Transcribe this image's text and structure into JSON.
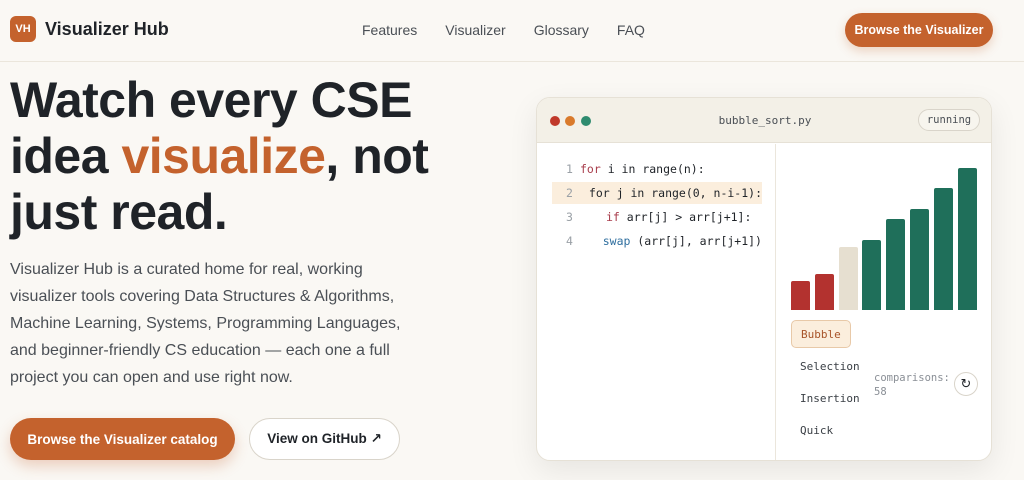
{
  "header": {
    "logo_text": "VH",
    "brand": "Visualizer Hub",
    "nav": [
      {
        "label": "Features"
      },
      {
        "label": "Visualizer"
      },
      {
        "label": "Glossary"
      },
      {
        "label": "FAQ"
      }
    ],
    "cta": "Browse the Visualizer"
  },
  "hero": {
    "title_part1": "Watch every CSE idea ",
    "title_accent": "visualize",
    "title_part2": ", not just read.",
    "description": "Visualizer Hub is a curated home for real, working visualizer tools covering Data Structures & Algorithms, Machine Learning, Systems, Programming Languages, and beginner-friendly CS education — each one a full project you can open and use right now.",
    "primary_button": "Browse the Visualizer catalog",
    "secondary_button": "View on GitHub ↗"
  },
  "visualizer": {
    "filename": "bubble_sort.py",
    "status": "running",
    "code": [
      {
        "num": "1",
        "keyword": "for",
        "keyword_type": "kw",
        "rest": " i in range(n):",
        "indent": 0,
        "highlight": false
      },
      {
        "num": "2",
        "keyword": "",
        "keyword_type": "kw",
        "rest": "for j in range(0, n-i-1):",
        "indent": 1,
        "highlight": true
      },
      {
        "num": "3",
        "keyword": "if",
        "keyword_type": "kw",
        "rest": " arr[j] > arr[j+1]:",
        "indent": 2,
        "highlight": false
      },
      {
        "num": "4",
        "keyword": "swap",
        "keyword_type": "fn",
        "rest": " (arr[j], arr[j+1])",
        "indent": 3,
        "highlight": false
      }
    ],
    "bars": [
      {
        "value": 29,
        "state": "compare"
      },
      {
        "value": 36,
        "state": "compare"
      },
      {
        "value": 63,
        "state": "unsorted"
      },
      {
        "value": 70,
        "state": "sorted"
      },
      {
        "value": 90,
        "state": "sorted"
      },
      {
        "value": 100,
        "state": "sorted"
      },
      {
        "value": 121,
        "state": "sorted"
      },
      {
        "value": 141,
        "state": "sorted"
      }
    ],
    "bar_colors": {
      "compare": "#b3322f",
      "unsorted": "#e6dfd0",
      "sorted": "#1f6f5a"
    },
    "algorithms": [
      {
        "label": "Bubble",
        "active": true
      },
      {
        "label": "Selection",
        "active": false
      },
      {
        "label": "Insertion",
        "active": false
      },
      {
        "label": "Quick",
        "active": false
      }
    ],
    "comparisons_label": "comparisons:",
    "comparisons_value": "58",
    "reset_icon": "↻"
  }
}
